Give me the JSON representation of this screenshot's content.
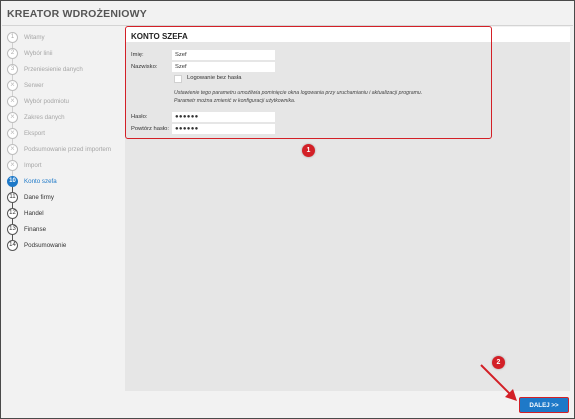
{
  "app": {
    "title": "KREATOR WDROŻENIOWY"
  },
  "steps": [
    {
      "num": "1",
      "label": "Witamy",
      "state": "done"
    },
    {
      "num": "2",
      "label": "Wybór linii",
      "state": "done"
    },
    {
      "num": "3",
      "label": "Przeniesienie danych",
      "state": "done"
    },
    {
      "num": "",
      "label": "Serwer",
      "state": "skipped"
    },
    {
      "num": "",
      "label": "Wybór podmiotu",
      "state": "skipped"
    },
    {
      "num": "",
      "label": "Zakres danych",
      "state": "skipped"
    },
    {
      "num": "",
      "label": "Eksport",
      "state": "skipped"
    },
    {
      "num": "",
      "label": "Podsumowanie przed importem",
      "state": "skipped"
    },
    {
      "num": "",
      "label": "Import",
      "state": "skipped"
    },
    {
      "num": "10",
      "label": "Konto szefa",
      "state": "active"
    },
    {
      "num": "11",
      "label": "Dane firmy",
      "state": "future"
    },
    {
      "num": "12",
      "label": "Handel",
      "state": "future"
    },
    {
      "num": "13",
      "label": "Finanse",
      "state": "future"
    },
    {
      "num": "14",
      "label": "Podsumowanie",
      "state": "future"
    }
  ],
  "form": {
    "section_title": "KONTO SZEFA",
    "first_name_label": "Imię:",
    "first_name_value": "Szef",
    "last_name_label": "Nazwisko:",
    "last_name_value": "Szef",
    "passwordless_label": "Logowanie bez hasła",
    "passwordless_checked": false,
    "hint_line1": "Ustawienie tego parametru umożliwia pominięcie okna logowania przy uruchamianiu i aktualizacji programu.",
    "hint_line2": "Parametr można zmienić w konfiguracji użytkownika.",
    "password_label": "Hasło:",
    "password_value": "●●●●●●",
    "repeat_password_label": "Powtórz hasło:",
    "repeat_password_value": "●●●●●●"
  },
  "annotations": {
    "badge_1": "1",
    "badge_2": "2"
  },
  "buttons": {
    "next_label": "DALEJ >>"
  },
  "colors": {
    "accent": "#1e79c8",
    "annotation_red": "#d32027"
  }
}
